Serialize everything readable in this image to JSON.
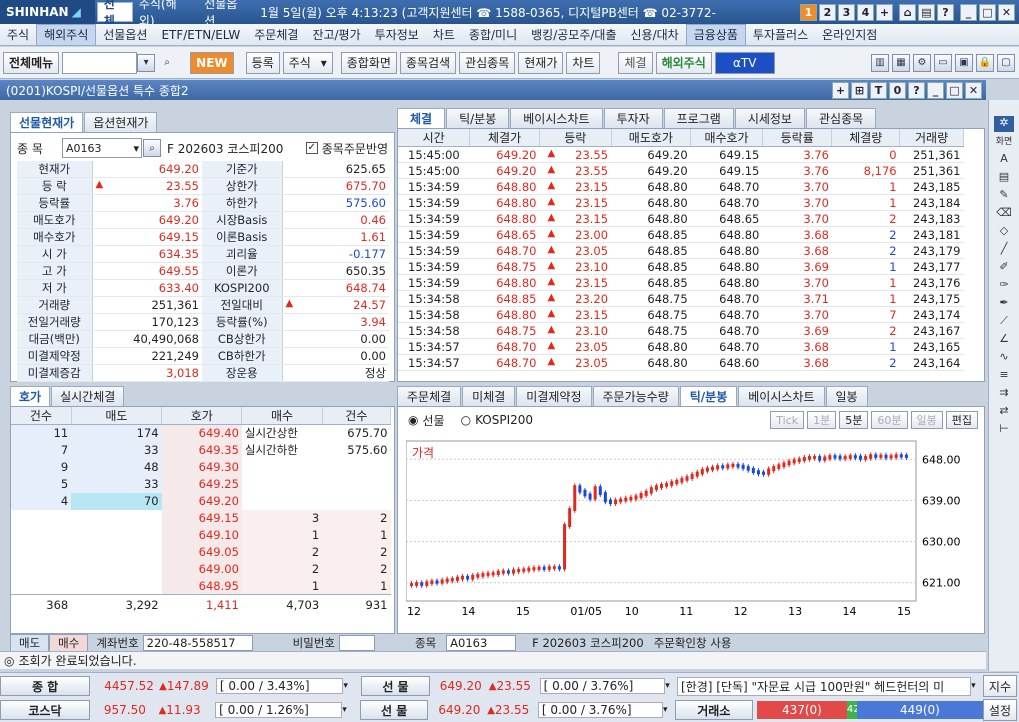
{
  "titlebar": {
    "logo": "SHINHAN",
    "tabs": [
      "전체",
      "주식(해외)",
      "선물옵션"
    ],
    "info": "1월 5일(월) 오후 4:13:23 (고객지원센터 ☎ 1588-0365, 디지털PB센터 ☎ 02-3772-",
    "numbers": [
      "1",
      "2",
      "3",
      "4",
      "+"
    ]
  },
  "menu": [
    "주식",
    "해외주식",
    "선물옵션",
    "ETF/ETN/ELW",
    "주문체결",
    "잔고/평가",
    "투자정보",
    "차트",
    "종합/미니",
    "뱅킹/공모주/대출",
    "신용/대차",
    "금융상품",
    "투자플러스",
    "온라인지점"
  ],
  "toolbar": {
    "menu_label": "전체메뉴",
    "new_label": "NEW",
    "register": "등록",
    "stock": "주식",
    "buttons": [
      "종합화면",
      "종목검색",
      "관심종목",
      "현재가",
      "차트"
    ],
    "conclusion": "체결",
    "overseas": "해외주식",
    "tv": "αTV"
  },
  "window": {
    "title": "(0201)KOSPI/선물옵션 특수 종합2"
  },
  "left": {
    "tabs": [
      "선물현재가",
      "옵션현재가"
    ],
    "code_label": "종 목",
    "code": "A0163",
    "name": "F 202603 코스피200",
    "check_label": "종목주문반영",
    "rows": [
      {
        "l1": "현재가",
        "v1": "649.20",
        "c1": "red",
        "l2": "기준가",
        "v2": "625.65",
        "c2": ""
      },
      {
        "l1": "등 락",
        "v1": "23.55",
        "c1": "red",
        "l2": "상한가",
        "v2": "675.70",
        "c2": "red",
        "arrow": true
      },
      {
        "l1": "등락률",
        "v1": "3.76",
        "c1": "red",
        "l2": "하한가",
        "v2": "575.60",
        "c2": "blue"
      },
      {
        "l1": "매도호가",
        "v1": "649.20",
        "c1": "red",
        "l2": "시장Basis",
        "v2": "0.46",
        "c2": "red"
      },
      {
        "l1": "매수호가",
        "v1": "649.15",
        "c1": "red",
        "l2": "이론Basis",
        "v2": "1.61",
        "c2": "red"
      },
      {
        "l1": "시 가",
        "v1": "634.35",
        "c1": "red",
        "l2": "괴리율",
        "v2": "-0.177",
        "c2": "blue"
      },
      {
        "l1": "고 가",
        "v1": "649.55",
        "c1": "red",
        "l2": "이론가",
        "v2": "650.35",
        "c2": ""
      },
      {
        "l1": "저 가",
        "v1": "633.40",
        "c1": "red",
        "l2": "KOSPI200",
        "v2": "648.74",
        "c2": "red"
      },
      {
        "l1": "거래량",
        "v1": "251,361",
        "c1": "",
        "l2": "전일대비",
        "v2": "24.57",
        "c2": "red",
        "arrow2": true
      },
      {
        "l1": "전일거래량",
        "v1": "170,123",
        "c1": "",
        "l2": "등락률(%)",
        "v2": "3.94",
        "c2": "red"
      },
      {
        "l1": "대금(백만)",
        "v1": "40,490,068",
        "c1": "",
        "l2": "CB상한가",
        "v2": "0.00",
        "c2": ""
      },
      {
        "l1": "미결제약정",
        "v1": "221,249",
        "c1": "",
        "l2": "CB하한가",
        "v2": "0.00",
        "c2": ""
      },
      {
        "l1": "미결제증감",
        "v1": "3,018",
        "c1": "red",
        "l2": "장운용",
        "v2": "정상",
        "c2": ""
      }
    ]
  },
  "orderbook": {
    "tabs": [
      "호가",
      "실시간체결"
    ],
    "headers": [
      "건수",
      "매도",
      "호가",
      "매수",
      "건수"
    ],
    "asks": [
      [
        "11",
        "174",
        "649.40"
      ],
      [
        "7",
        "33",
        "649.35"
      ],
      [
        "9",
        "48",
        "649.30"
      ],
      [
        "5",
        "33",
        "649.25"
      ],
      [
        "4",
        "70",
        "649.20"
      ]
    ],
    "bids": [
      [
        "649.15",
        "3",
        "2"
      ],
      [
        "649.10",
        "1",
        "1"
      ],
      [
        "649.05",
        "2",
        "2"
      ],
      [
        "649.00",
        "2",
        "2"
      ],
      [
        "648.95",
        "1",
        "1"
      ]
    ],
    "limits": [
      {
        "label": "실시간상한",
        "value": "675.70"
      },
      {
        "label": "실시간하한",
        "value": "575.60"
      }
    ],
    "totals": [
      "368",
      "3,292",
      "1,411",
      "4,703",
      "931"
    ]
  },
  "trades": {
    "tabs": [
      "체결",
      "틱/분봉",
      "베이시스차트",
      "투자자",
      "프로그램",
      "시세정보",
      "관심종목"
    ],
    "headers": [
      "시간",
      "체결가",
      "등락",
      "매도호가",
      "매수호가",
      "등락률",
      "체결량",
      "거래량"
    ],
    "rows": [
      [
        "15:45:00",
        "649.20",
        "23.55",
        "649.20",
        "649.15",
        "3.76",
        "0",
        "251,361",
        "r"
      ],
      [
        "15:45:00",
        "649.20",
        "23.55",
        "649.20",
        "649.15",
        "3.76",
        "8,176",
        "251,361",
        "r"
      ],
      [
        "15:34:59",
        "648.80",
        "23.15",
        "648.80",
        "648.70",
        "3.70",
        "1",
        "243,185",
        "r"
      ],
      [
        "15:34:59",
        "648.80",
        "23.15",
        "648.80",
        "648.70",
        "3.70",
        "1",
        "243,184",
        "r"
      ],
      [
        "15:34:59",
        "648.80",
        "23.15",
        "648.80",
        "648.65",
        "3.70",
        "2",
        "243,183",
        "r"
      ],
      [
        "15:34:59",
        "648.65",
        "23.00",
        "648.85",
        "648.80",
        "3.68",
        "2",
        "243,181",
        "b"
      ],
      [
        "15:34:59",
        "648.70",
        "23.05",
        "648.85",
        "648.80",
        "3.68",
        "2",
        "243,179",
        "b"
      ],
      [
        "15:34:59",
        "648.75",
        "23.10",
        "648.85",
        "648.80",
        "3.69",
        "1",
        "243,177",
        "b"
      ],
      [
        "15:34:59",
        "648.80",
        "23.15",
        "648.85",
        "648.80",
        "3.70",
        "1",
        "243,176",
        "r"
      ],
      [
        "15:34:58",
        "648.85",
        "23.20",
        "648.75",
        "648.70",
        "3.71",
        "1",
        "243,175",
        "r"
      ],
      [
        "15:34:58",
        "648.80",
        "23.15",
        "648.75",
        "648.70",
        "3.70",
        "7",
        "243,174",
        "r"
      ],
      [
        "15:34:58",
        "648.75",
        "23.10",
        "648.75",
        "648.70",
        "3.69",
        "2",
        "243,167",
        "r"
      ],
      [
        "15:34:57",
        "648.70",
        "23.05",
        "648.80",
        "648.70",
        "3.68",
        "1",
        "243,165",
        "b"
      ],
      [
        "15:34:57",
        "648.70",
        "23.05",
        "648.80",
        "648.60",
        "3.68",
        "2",
        "243,164",
        "b"
      ]
    ]
  },
  "chartpanel": {
    "tabs": [
      "주문체결",
      "미체결",
      "미결제약정",
      "주문가능수량",
      "틱/분봉",
      "베이시스차트",
      "일봉"
    ],
    "radio": [
      "선물",
      "KOSPI200"
    ],
    "buttons": [
      "Tick",
      "1분",
      "5분",
      "60분",
      "일봉",
      "편집"
    ],
    "legend": "가격"
  },
  "chart_data": {
    "type": "candlestick",
    "ylim": [
      617,
      652
    ],
    "yticks": [
      "648.00",
      "639.00",
      "630.00",
      "621.00"
    ],
    "ytick_values": [
      648,
      639,
      630,
      621
    ],
    "xticks": [
      "12",
      "14",
      "15",
      "01/05",
      "10",
      "11",
      "12",
      "13",
      "14",
      "15"
    ],
    "values": [
      620.6,
      620.8,
      620.6,
      621.0,
      621.2,
      621.1,
      621.4,
      621.6,
      621.7,
      622.0,
      622.2,
      622.0,
      622.4,
      622.6,
      622.8,
      622.9,
      623.0,
      623.3,
      623.4,
      623.3,
      623.6,
      623.7,
      623.8,
      624.0,
      624.1,
      624.2,
      624.1,
      624.3,
      624.3,
      624.2,
      633.5,
      637.0,
      642.0,
      641.0,
      640.2,
      639.5,
      641.8,
      640.5,
      638.9,
      638.5,
      638.9,
      639.1,
      639.3,
      639.5,
      639.8,
      640.3,
      640.8,
      641.6,
      642.0,
      642.3,
      642.5,
      642.9,
      643.2,
      643.6,
      644.0,
      644.5,
      645.0,
      645.6,
      645.9,
      646.1,
      646.4,
      646.3,
      646.6,
      646.7,
      646.5,
      646.2,
      645.8,
      645.3,
      645.0,
      644.9,
      645.7,
      646.2,
      646.6,
      647.0,
      647.4,
      647.7,
      647.9,
      648.2,
      648.4,
      648.4,
      648.0,
      648.3,
      648.6,
      648.5,
      648.3,
      648.4,
      648.6,
      648.5,
      648.2,
      648.4,
      648.8,
      648.6,
      648.7,
      648.5,
      648.6,
      648.8,
      648.7,
      648.6
    ]
  },
  "chart_bottom": {
    "account_label": "계좌번호",
    "account": "220-48-558517",
    "pw_label": "비밀번호",
    "code_label": "종목",
    "code": "A0163",
    "name": "F 202603 코스피200",
    "check": "주문확인창 사용",
    "tabs": [
      "매도",
      "매수"
    ]
  },
  "status": "조회가 완료되었습니다.",
  "bottom": {
    "row1": {
      "label": "종 합",
      "v1": "4457.52",
      "d1": "147.89",
      "p1": "[ 0.00 / 3.43%]",
      "label2": "선 물",
      "v2": "649.20",
      "d2": "23.55",
      "p2": "[ 0.00 / 3.76%]",
      "news": "[한경] [단독] \"자문료 시급 100만원\" 헤드헌터의 미",
      "btn": "지수"
    },
    "row2": {
      "label": "코스닥",
      "v1": "957.50",
      "d1": "11.93",
      "p1": "[ 0.00 / 1.26%]",
      "label2": "선 물",
      "v2": "649.20",
      "d2": "23.55",
      "p2": "[ 0.00 / 3.76%]",
      "exch": "거래소",
      "up": "437(0)",
      "mid": "42",
      "down": "449(0)",
      "btn": "설정"
    }
  }
}
